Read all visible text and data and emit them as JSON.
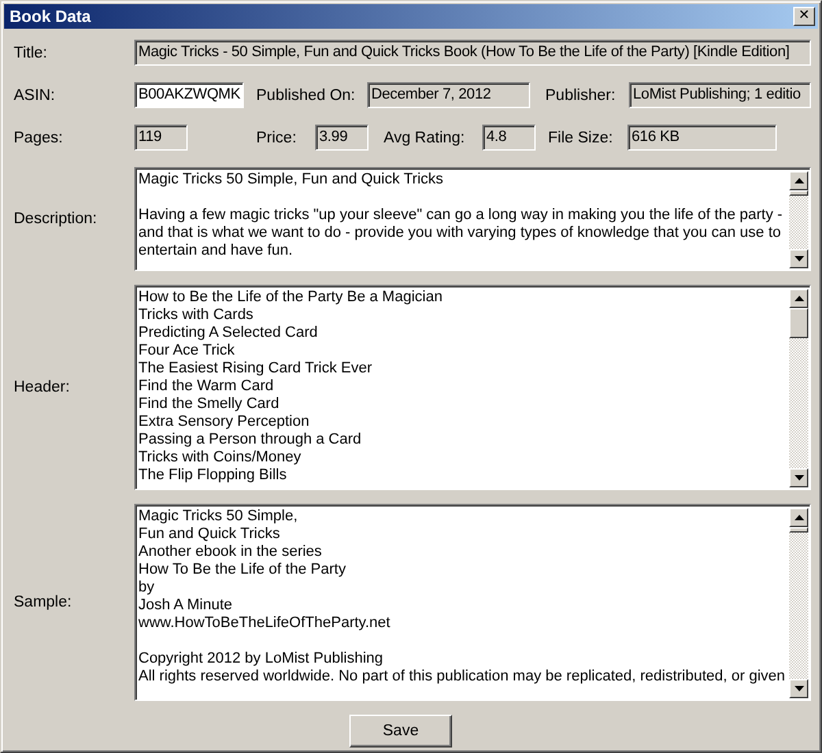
{
  "window": {
    "title": "Book Data",
    "close": "✕"
  },
  "fields": [
    {
      "label": "Title:",
      "value": "Magic Tricks - 50 Simple, Fun and Quick Tricks Book (How To Be the Life of the Party) [Kindle Edition]"
    },
    {
      "label": "ASIN:",
      "value": "B00AKZWQMK",
      "editable": true
    },
    {
      "label": "Published On:",
      "value": "December 7, 2012"
    },
    {
      "label": "Publisher:",
      "value": "LoMist Publishing; 1 editio"
    },
    {
      "label": "Pages:",
      "value": "119"
    },
    {
      "label": "Price:",
      "value": "3.99"
    },
    {
      "label": "Avg Rating:",
      "value": "4.8"
    },
    {
      "label": "File Size:",
      "value": "616 KB"
    }
  ],
  "description": {
    "label": "Description:",
    "paragraphs": [
      [
        "Magic Tricks 50 Simple, Fun and Quick Tricks"
      ],
      [
        "Having a few magic tricks \"up your sleeve\" can go a long way in making you the life of the party - and that is what we want to do - provide you with varying types of knowledge that you can use to entertain and have fun."
      ]
    ]
  },
  "header": {
    "label": "Header:",
    "paragraphs": [
      [
        "How to Be the Life of the Party  Be a Magician",
        "Tricks with Cards",
        "Predicting A Selected Card",
        "Four Ace Trick",
        "The Easiest Rising Card Trick Ever",
        "Find the Warm Card",
        "Find the Smelly Card",
        "Extra Sensory Perception",
        "Passing a Person through a Card",
        "Tricks with Coins/Money",
        "The Flip Flopping Bills"
      ]
    ]
  },
  "sample": {
    "label": "Sample:",
    "paragraphs": [
      [
        "Magic Tricks  50 Simple,",
        "Fun and Quick Tricks",
        "Another ebook in the series",
        "How To Be the Life of the Party",
        "by",
        "Josh A Minute",
        "www.HowToBeTheLifeOfTheParty.net"
      ],
      [
        "Copyright  2012 by LoMist Publishing",
        "All rights reserved worldwide. No part of this publication may be replicated, redistributed, or given"
      ]
    ]
  },
  "buttons": [
    "Save"
  ]
}
